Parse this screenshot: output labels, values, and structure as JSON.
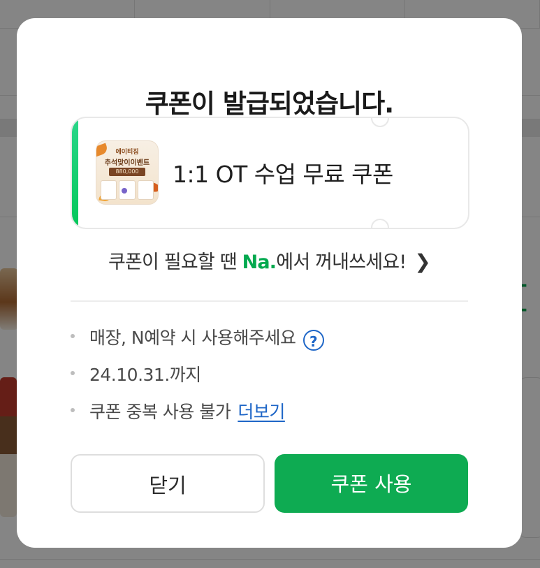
{
  "modal": {
    "title": "쿠폰이 발급되었습니다.",
    "coupon": {
      "name": "1:1 OT 수업 무료 쿠폰",
      "thumbnail": {
        "caption_top": "에이티짐",
        "caption_main": "추석맞이이벤트",
        "price": "880,000"
      },
      "accent_color": "#03c75a"
    },
    "helper": {
      "prefix": "쿠폰이 필요할 땐 ",
      "brand": "Na.",
      "suffix": "에서 꺼내쓰세요!",
      "chevron_icon": "chevron-right-icon"
    },
    "info": [
      {
        "text": "매장, N예약 시 사용해주세요",
        "icon": "help-icon"
      },
      {
        "text": "24.10.31.까지"
      },
      {
        "text": "쿠폰 중복 사용 불가",
        "link": "더보기"
      }
    ],
    "buttons": {
      "close_label": "닫기",
      "use_label": "쿠폰 사용",
      "primary_color": "#0eab52"
    }
  }
}
